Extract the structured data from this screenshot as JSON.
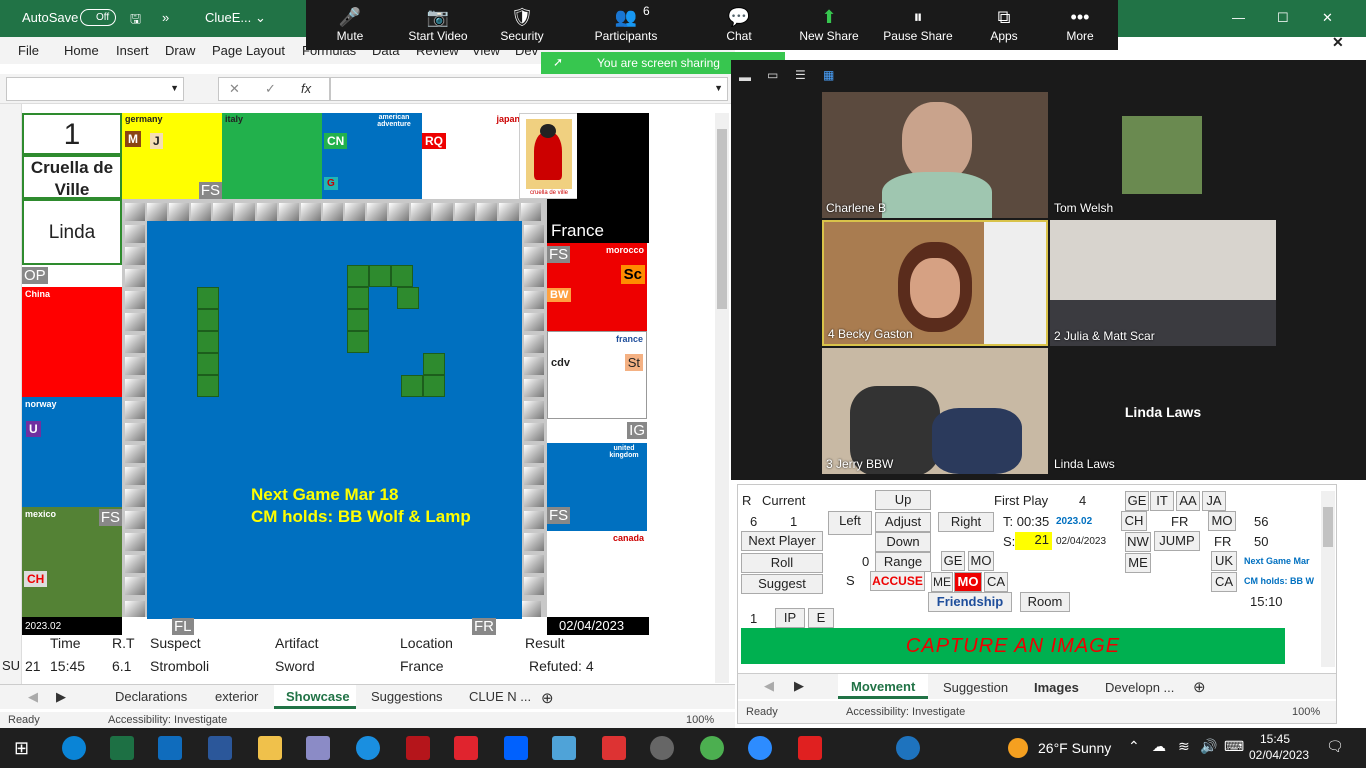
{
  "excel": {
    "autosave_label": "AutoSave",
    "autosave_state": "Off",
    "file_name": "ClueE...",
    "tabs": [
      "File",
      "Home",
      "Insert",
      "Draw",
      "Page Layout",
      "Formulas",
      "Data",
      "Review",
      "View",
      "Dev"
    ],
    "fx": "fx",
    "x": "✕",
    "check": "✓"
  },
  "board": {
    "player_number": "1",
    "character": "Cruella de Ville",
    "player_name": "Linda",
    "regions": {
      "germany": "germany",
      "italy": "italy",
      "american": "american adventure",
      "japan": "japan",
      "france": "France",
      "morocco": "morocco",
      "china": "China",
      "norway": "norway",
      "mexico": "mexico",
      "france2": "france",
      "uk": "united kingdom",
      "canada": "canada"
    },
    "badges": {
      "m": "M",
      "j": "J",
      "cn": "CN",
      "g": "G",
      "rq": "RQ",
      "sc": "Sc",
      "bw": "BW",
      "cdv": "cdv",
      "st": "St",
      "u": "U",
      "ch": "CH"
    },
    "tags": {
      "fs1": "FS",
      "fs2": "FS",
      "fs3": "FS",
      "fs4": "FS",
      "op": "OP",
      "ig": "IG",
      "fl": "FL",
      "fr": "FR"
    },
    "card_caption": "cruella de ville",
    "msg1": "Next Game Mar 18",
    "msg2": "CM holds:  BB Wolf & Lamp",
    "footer_left": "2023.02",
    "footer_date": "02/04/2023"
  },
  "log": {
    "headers": [
      "Time",
      "R.T",
      "Suspect",
      "Artifact",
      "Location",
      "Result"
    ],
    "row": {
      "su": "SU",
      "num": "21",
      "time": "15:45",
      "rt": "6.1",
      "suspect": "Stromboli",
      "artifact": "Sword",
      "location": "France",
      "result": "Refuted: 4"
    }
  },
  "sheets1": [
    "Declarations",
    "exterior",
    "Showcase",
    "Suggestions",
    "CLUE N ..."
  ],
  "status1": {
    "ready": "Ready",
    "access": "Accessibility: Investigate",
    "zoom": "100%"
  },
  "zoom": {
    "buttons": [
      {
        "label": "Mute",
        "icon": "🎤"
      },
      {
        "label": "Start Video",
        "icon": "📷"
      },
      {
        "label": "Security",
        "icon": "🛡"
      },
      {
        "label": "Participants",
        "icon": "👥"
      },
      {
        "label": "Chat",
        "icon": "💬"
      },
      {
        "label": "New Share",
        "icon": "⬆"
      },
      {
        "label": "Pause Share",
        "icon": "⏸"
      },
      {
        "label": "Apps",
        "icon": "⧉"
      },
      {
        "label": "More",
        "icon": "•••"
      }
    ],
    "participants_count": "6",
    "share_msg": "You are screen sharing",
    "tiles": [
      "Charlene B",
      "Tom Welsh",
      "4 Becky Gaston",
      "2 Julia & Matt Scar",
      "3 Jerry BBW",
      "Linda Laws"
    ],
    "center_name": "Linda Laws"
  },
  "panel": {
    "r": "R",
    "current": "Current",
    "up": "Up",
    "first_play": "First Play",
    "first_play_val": "4",
    "ge": "GE",
    "it": "IT",
    "aa": "AA",
    "ja": "JA",
    "six": "6",
    "one": "1",
    "left": "Left",
    "adjust": "Adjust",
    "right": "Right",
    "t_label": "T: 00:35",
    "date_code": "2023.02",
    "ch": "CH",
    "fr": "FR",
    "mo": "MO",
    "n56": "56",
    "next_player": "Next Player",
    "down": "Down",
    "s_label": "S:",
    "s_val": "21",
    "date": "02/04/2023",
    "nw": "NW",
    "jump": "JUMP",
    "fr2": "FR",
    "n50": "50",
    "roll": "Roll",
    "zero": "0",
    "range": "Range",
    "ge2": "GE",
    "mo2": "MO",
    "me": "ME",
    "uk": "UK",
    "next_game": "Next Game Mar",
    "suggest": "Suggest",
    "s": "S",
    "accuse": "ACCUSE",
    "me2": "ME",
    "mo3": "MO",
    "ca": "CA",
    "ca2": "CA",
    "cm_holds": "CM holds: BB W",
    "friendship": "Friendship",
    "room": "Room",
    "time2": "15:10",
    "one2": "1",
    "ip": "IP",
    "e": "E",
    "capture": "CAPTURE AN IMAGE"
  },
  "sheets2": [
    "Movement",
    "Suggestion",
    "Images",
    "Developn ..."
  ],
  "status2": {
    "ready": "Ready",
    "access": "Accessibility: Investigate",
    "zoom": "100%"
  },
  "taskbar": {
    "weather": "26°F  Sunny",
    "time": "15:45",
    "date": "02/04/2023"
  }
}
